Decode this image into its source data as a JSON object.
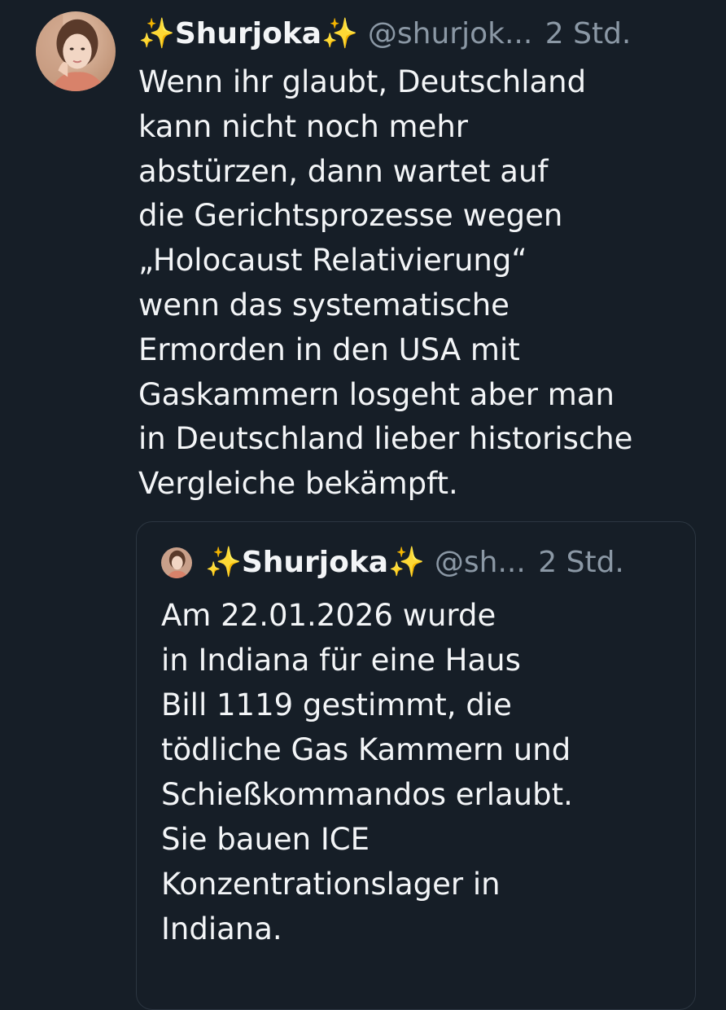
{
  "post": {
    "author": {
      "name": "Shurjoka",
      "sparkle_left": "✨",
      "sparkle_right": "✨",
      "handle": "@shurjok...",
      "timestamp": "2 Std."
    },
    "text_lines": [
      "Wenn ihr glaubt, Deutschland",
      "kann nicht noch mehr",
      "abstürzen, dann wartet auf",
      "die Gerichtsprozesse wegen",
      "„Holocaust Relativierung“",
      "wenn das systematische",
      "Ermorden in den USA mit",
      "Gaskammern losgeht aber man",
      "in Deutschland lieber historische",
      "Vergleiche bekämpft."
    ]
  },
  "quoted_post": {
    "author": {
      "name": "Shurjoka",
      "sparkle_left": "✨",
      "sparkle_right": "✨",
      "handle": "@sh...",
      "timestamp": "2 Std."
    },
    "text_lines": [
      "Am 22.01.2026 wurde",
      "in Indiana für eine Haus",
      "Bill 1119 gestimmt, die",
      "tödliche Gas Kammern und",
      "Schießkommandos erlaubt.",
      "Sie bauen ICE",
      "Konzentrationslager in",
      "Indiana."
    ]
  },
  "icons": {
    "avatar": "user-avatar-photo",
    "sparkle": "sparkles-emoji"
  },
  "colors": {
    "background": "#161e27",
    "text": "#f3f5f7",
    "secondary_text": "#8b98a5",
    "border": "#2c3641",
    "sparkle": "#f6c23a"
  }
}
